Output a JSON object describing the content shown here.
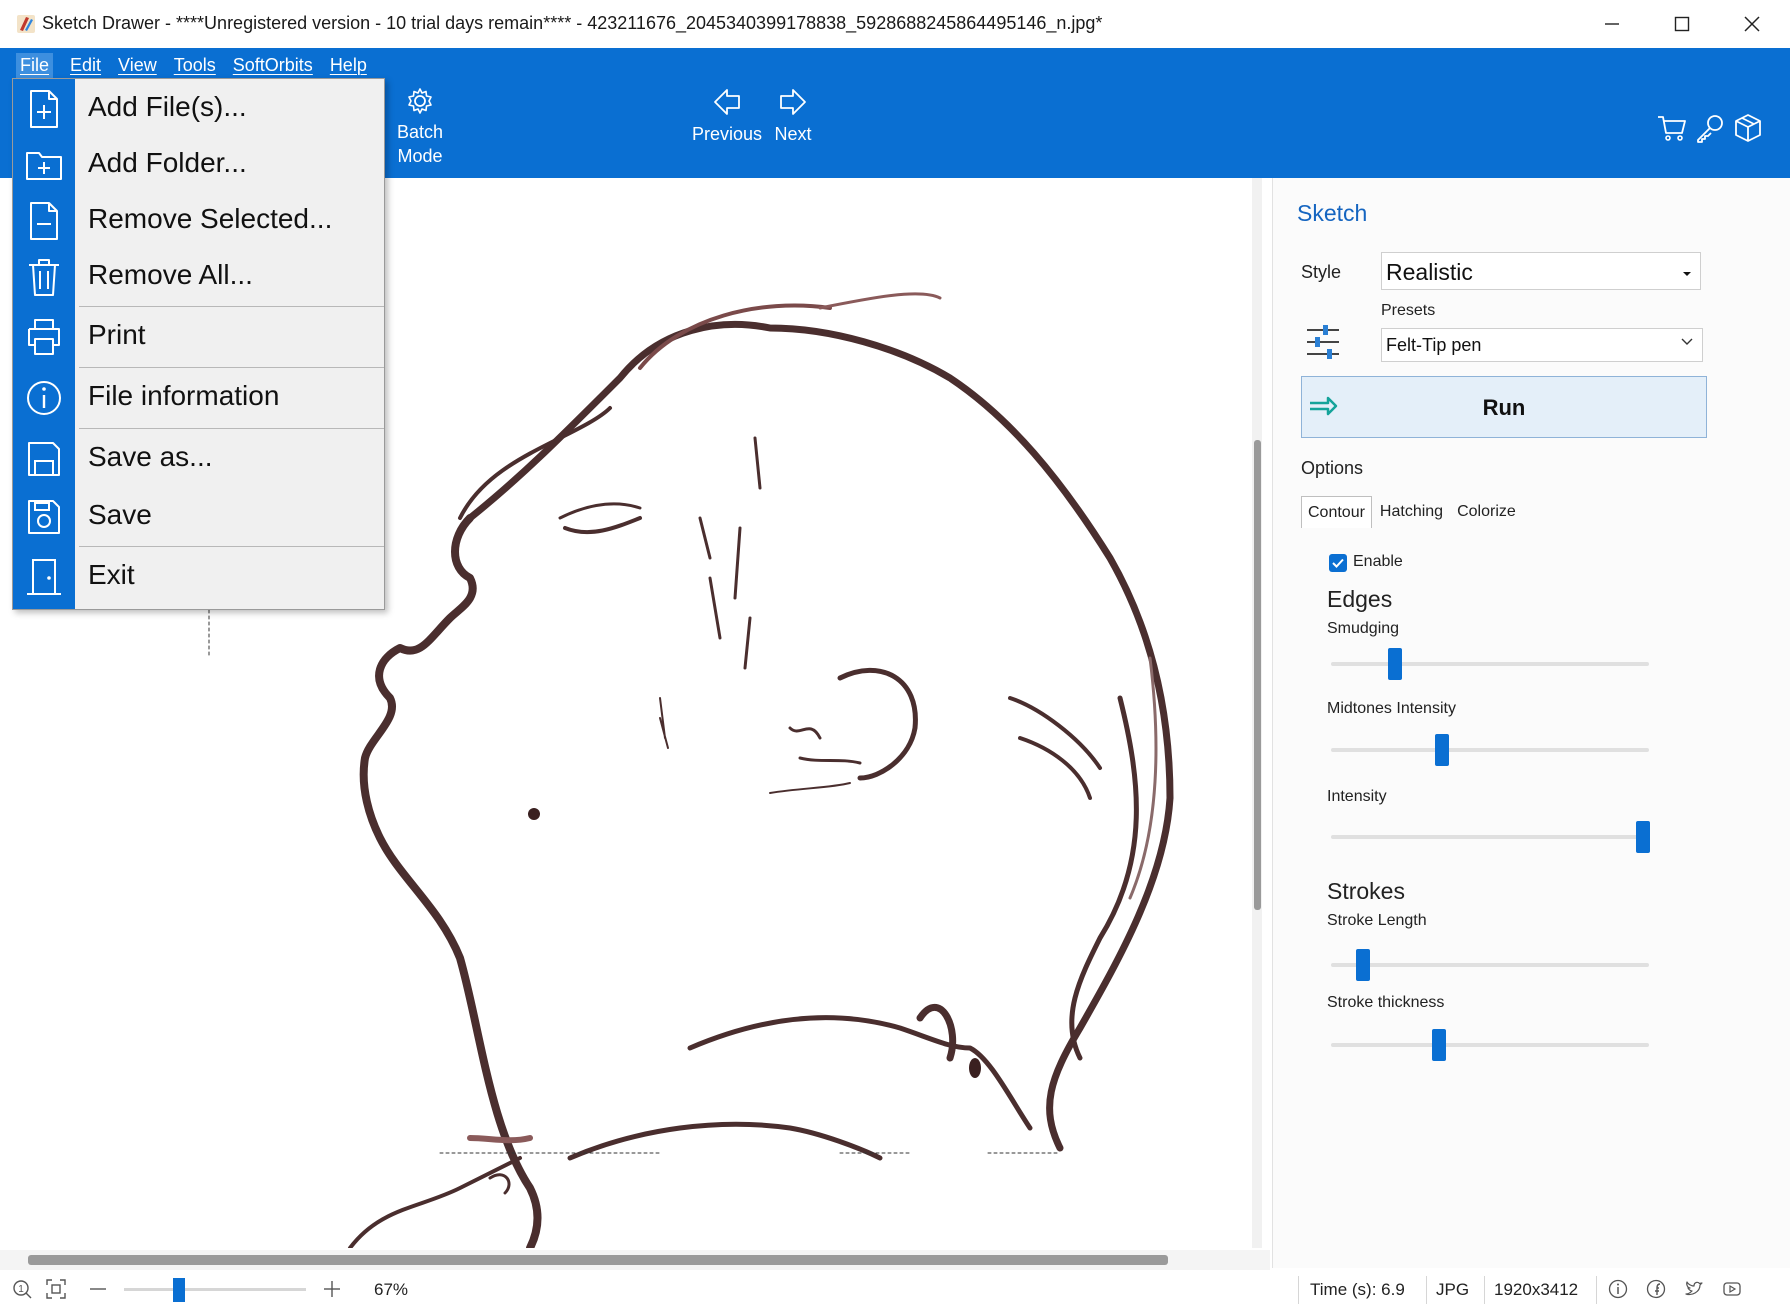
{
  "window": {
    "title": "Sketch Drawer - ****Unregistered version - 10 trial days remain**** - 423211676_2045340399178838_5928688245864495146_n.jpg*",
    "minimize_icon": "minimize-icon",
    "maximize_icon": "maximize-icon",
    "close_icon": "close-icon"
  },
  "menubar": {
    "items": [
      "File",
      "Edit",
      "View",
      "Tools",
      "SoftOrbits",
      "Help"
    ]
  },
  "ribbon": {
    "batch_mode": "Batch\nMode",
    "batch_line1": "Batch",
    "batch_line2": "Mode",
    "previous": "Previous",
    "next": "Next",
    "right_icons": [
      "cart-icon",
      "key-icon",
      "box-icon"
    ]
  },
  "file_menu": {
    "items": [
      {
        "label": "Add File(s)...",
        "icon": "add-file-icon"
      },
      {
        "label": "Add Folder...",
        "icon": "add-folder-icon"
      },
      {
        "label": "Remove Selected...",
        "icon": "remove-file-icon"
      },
      {
        "label": "Remove All...",
        "icon": "trash-icon"
      },
      {
        "label": "Print",
        "icon": "printer-icon"
      },
      {
        "label": "File information",
        "icon": "info-icon"
      },
      {
        "label": "Save as...",
        "icon": "save-as-icon"
      },
      {
        "label": "Save",
        "icon": "save-icon"
      },
      {
        "label": "Exit",
        "icon": "exit-door-icon"
      }
    ]
  },
  "panel": {
    "title": "Sketch",
    "style_label": "Style",
    "style_value": "Realistic",
    "presets_label": "Presets",
    "presets_value": "Felt-Tip pen",
    "run_label": "Run",
    "options_label": "Options",
    "tabs": [
      "Contour",
      "Hatching",
      "Colorize"
    ],
    "active_tab": "Contour",
    "enable_label": "Enable",
    "enable_checked": true,
    "edges_heading": "Edges",
    "strokes_heading": "Strokes",
    "sliders": [
      {
        "label": "Smudging",
        "value": 0.2
      },
      {
        "label": "Midtones Intensity",
        "value": 0.35
      },
      {
        "label": "Intensity",
        "value": 0.98
      },
      {
        "label": "Stroke Length",
        "value": 0.1
      },
      {
        "label": "Stroke thickness",
        "value": 0.34
      }
    ]
  },
  "status": {
    "zoom_value": 0.3,
    "zoom_percent": "67%",
    "time": "Time (s): 6.9",
    "format": "JPG",
    "dimensions": "1920x3412"
  },
  "colors": {
    "accent": "#0a6fd2",
    "run_bg": "#e4eff9",
    "title_link": "#1565c0",
    "sketch_stroke": "#4a2e2e"
  }
}
